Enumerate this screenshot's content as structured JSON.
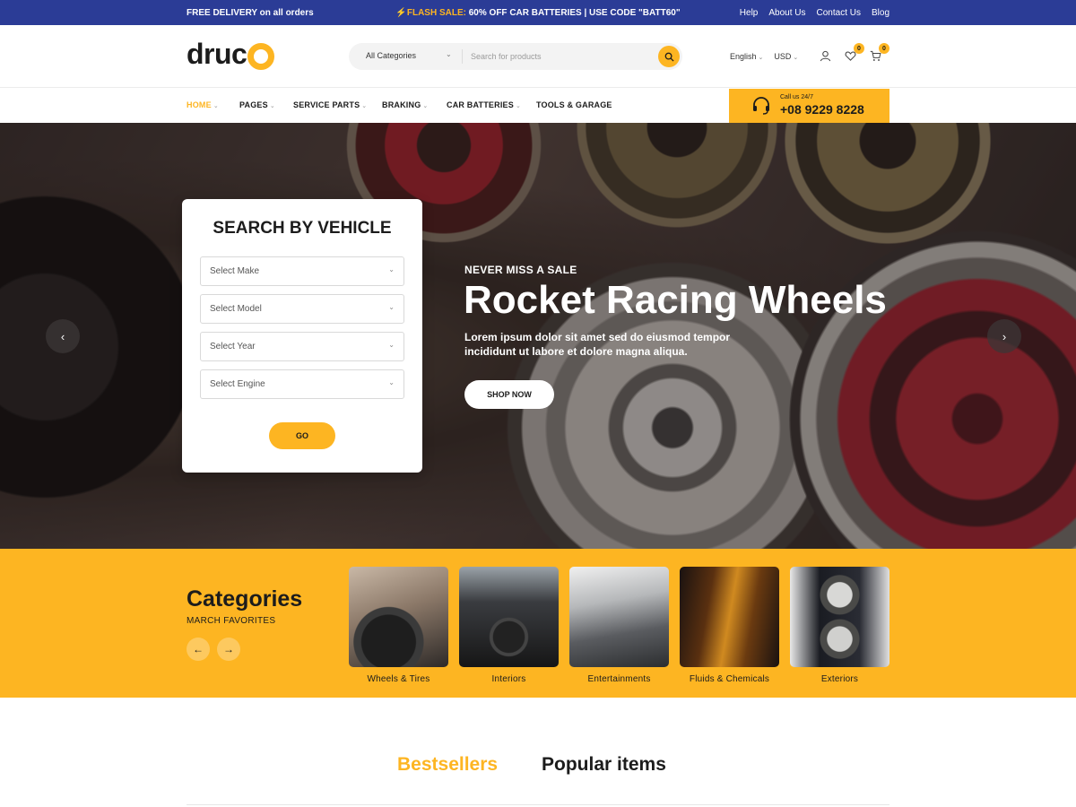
{
  "topbar": {
    "free_delivery": "FREE DELIVERY on all orders",
    "flash_label": "FLASH SALE:",
    "flash_text": " 60% OFF CAR BATTERIES | USE CODE \"BATT60\"",
    "links": [
      "Help",
      "About Us",
      "Contact Us",
      "Blog"
    ]
  },
  "header": {
    "logo": "druc",
    "category": "All Categories",
    "search_placeholder": "Search for products",
    "language": "English",
    "currency": "USD",
    "wishlist_count": "0",
    "cart_count": "0"
  },
  "nav": {
    "items": [
      "HOME",
      "PAGES",
      "SERVICE PARTS",
      "BRAKING",
      "CAR BATTERIES",
      "TOOLS & GARAGE"
    ],
    "call_label": "Call us 24/7",
    "phone": "+08 9229 8228"
  },
  "hero": {
    "eyebrow": "NEVER MISS A SALE",
    "headline": "Rocket Racing Wheels",
    "description": "Lorem ipsum dolor sit amet sed do eiusmod tempor incididunt ut labore et dolore magna aliqua.",
    "cta": "SHOP NOW"
  },
  "vehicle_search": {
    "title": "SEARCH BY VEHICLE",
    "selects": [
      "Select Make",
      "Select Model",
      "Select Year",
      "Select Engine"
    ],
    "go": "GO"
  },
  "categories": {
    "title": "Categories",
    "subtitle": "MARCH FAVORITES",
    "items": [
      "Wheels & Tires",
      "Interiors",
      "Entertainments",
      "Fluids & Chemicals",
      "Exteriors"
    ]
  },
  "tabs": [
    "Bestsellers",
    "Popular items"
  ],
  "colors": {
    "accent": "#fdb522",
    "topbar": "#2b3c96",
    "text": "#1c1c1c"
  }
}
